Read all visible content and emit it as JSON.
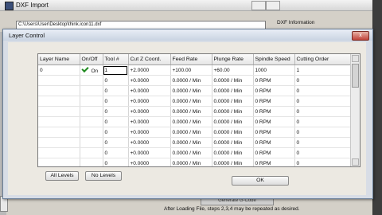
{
  "bg_window": {
    "title": "DXF Import",
    "file_path": "C:\\Users\\User\\Desktop\\think.icon11.dxf",
    "dxf_info_label": "DXF Information",
    "bottom_button_label": "Generate G-Code",
    "hint": "After Loading File, steps 2,3,4 may be repeated as desired."
  },
  "dialog": {
    "title": "Layer Control",
    "close_glyph": "x",
    "columns": [
      "Layer Name",
      "On/Off",
      "Tool #",
      "Cut Z Coord.",
      "Feed Rate",
      "Plunge Rate",
      "Spindle Speed",
      "Cutting Order"
    ],
    "rows": [
      {
        "layer": "0",
        "onoff": "On",
        "checked": true,
        "tool": "1",
        "cutz": "+2.0000",
        "feed": "+100.00",
        "plunge": "+60.00",
        "spindle": "1000",
        "order": "1"
      },
      {
        "layer": "",
        "onoff": "",
        "checked": false,
        "tool": "0",
        "cutz": "+0.0000",
        "feed": "0.0000 / Min",
        "plunge": "0.0000 / Min",
        "spindle": "0 RPM",
        "order": "0"
      },
      {
        "layer": "",
        "onoff": "",
        "checked": false,
        "tool": "0",
        "cutz": "+0.0000",
        "feed": "0.0000 / Min",
        "plunge": "0.0000 / Min",
        "spindle": "0 RPM",
        "order": "0"
      },
      {
        "layer": "",
        "onoff": "",
        "checked": false,
        "tool": "0",
        "cutz": "+0.0000",
        "feed": "0.0000 / Min",
        "plunge": "0.0000 / Min",
        "spindle": "0 RPM",
        "order": "0"
      },
      {
        "layer": "",
        "onoff": "",
        "checked": false,
        "tool": "0",
        "cutz": "+0.0000",
        "feed": "0.0000 / Min",
        "plunge": "0.0000 / Min",
        "spindle": "0 RPM",
        "order": "0"
      },
      {
        "layer": "",
        "onoff": "",
        "checked": false,
        "tool": "0",
        "cutz": "+0.0000",
        "feed": "0.0000 / Min",
        "plunge": "0.0000 / Min",
        "spindle": "0 RPM",
        "order": "0"
      },
      {
        "layer": "",
        "onoff": "",
        "checked": false,
        "tool": "0",
        "cutz": "+0.0000",
        "feed": "0.0000 / Min",
        "plunge": "0.0000 / Min",
        "spindle": "0 RPM",
        "order": "0"
      },
      {
        "layer": "",
        "onoff": "",
        "checked": false,
        "tool": "0",
        "cutz": "+0.0000",
        "feed": "0.0000 / Min",
        "plunge": "0.0000 / Min",
        "spindle": "0 RPM",
        "order": "0"
      },
      {
        "layer": "",
        "onoff": "",
        "checked": false,
        "tool": "0",
        "cutz": "+0.0000",
        "feed": "0.0000 / Min",
        "plunge": "0.0000 / Min",
        "spindle": "0 RPM",
        "order": "0"
      },
      {
        "layer": "",
        "onoff": "",
        "checked": false,
        "tool": "0",
        "cutz": "+0.0000",
        "feed": "0.0000 / Min",
        "plunge": "0.0000 / Min",
        "spindle": "0 RPM",
        "order": "0"
      }
    ],
    "buttons": {
      "all_levels": "All Levels",
      "no_levels": "No Levels",
      "ok": "OK"
    }
  }
}
